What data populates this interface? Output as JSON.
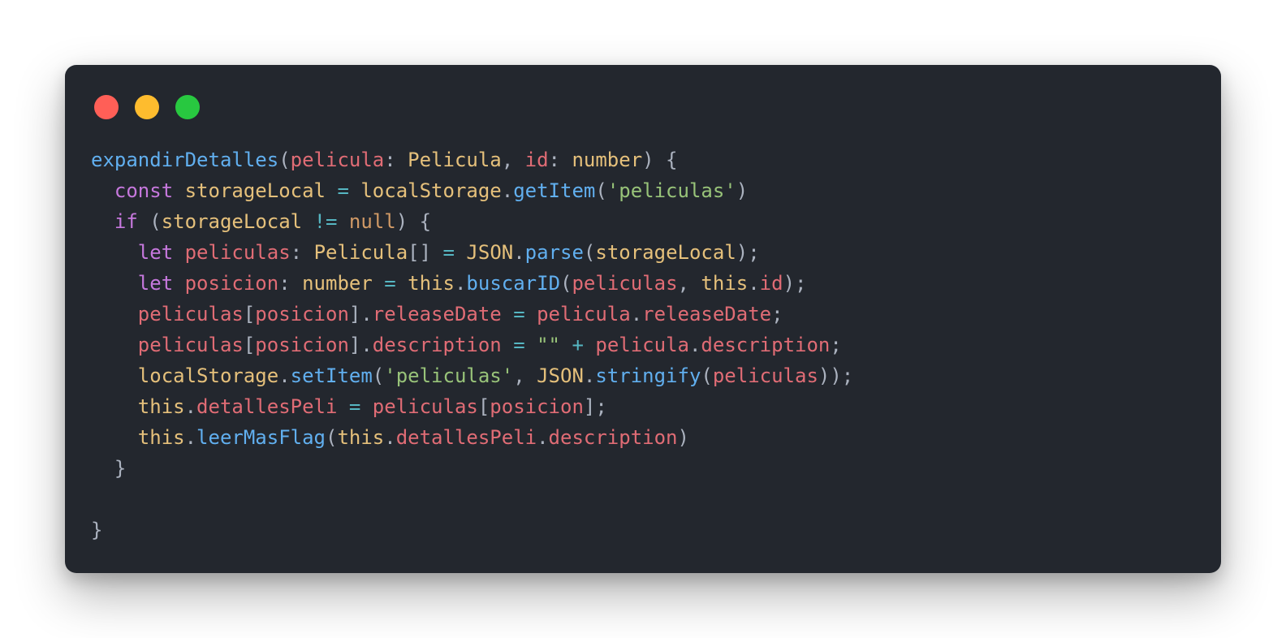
{
  "window": {
    "controls": [
      {
        "name": "close-dot",
        "color": "#ff5f57"
      },
      {
        "name": "minimize-dot",
        "color": "#febc2e"
      },
      {
        "name": "maximize-dot",
        "color": "#28c840"
      }
    ]
  },
  "colors": {
    "default": "#abb2bf",
    "fn": "#61afef",
    "var": "#e06c75",
    "type": "#e5c07b",
    "keyword": "#c678dd",
    "operator": "#56b6c2",
    "string": "#98c379",
    "literal": "#d19a66"
  },
  "code": {
    "lines": [
      [
        [
          "fn",
          "expandirDetalles"
        ],
        [
          "default",
          "("
        ],
        [
          "var",
          "pelicula"
        ],
        [
          "default",
          ": "
        ],
        [
          "type",
          "Pelicula"
        ],
        [
          "default",
          ", "
        ],
        [
          "var",
          "id"
        ],
        [
          "default",
          ": "
        ],
        [
          "type",
          "number"
        ],
        [
          "default",
          ") {"
        ]
      ],
      [
        [
          "default",
          "  "
        ],
        [
          "keyword",
          "const"
        ],
        [
          "default",
          " "
        ],
        [
          "type",
          "storageLocal"
        ],
        [
          "default",
          " "
        ],
        [
          "operator",
          "="
        ],
        [
          "default",
          " "
        ],
        [
          "type",
          "localStorage"
        ],
        [
          "default",
          "."
        ],
        [
          "fn",
          "getItem"
        ],
        [
          "default",
          "("
        ],
        [
          "string",
          "'peliculas'"
        ],
        [
          "default",
          ")"
        ]
      ],
      [
        [
          "default",
          "  "
        ],
        [
          "keyword",
          "if"
        ],
        [
          "default",
          " ("
        ],
        [
          "type",
          "storageLocal"
        ],
        [
          "default",
          " "
        ],
        [
          "operator",
          "!="
        ],
        [
          "default",
          " "
        ],
        [
          "literal",
          "null"
        ],
        [
          "default",
          ") {"
        ]
      ],
      [
        [
          "default",
          "    "
        ],
        [
          "keyword",
          "let"
        ],
        [
          "default",
          " "
        ],
        [
          "var",
          "peliculas"
        ],
        [
          "default",
          ": "
        ],
        [
          "type",
          "Pelicula"
        ],
        [
          "default",
          "[] "
        ],
        [
          "operator",
          "="
        ],
        [
          "default",
          " "
        ],
        [
          "type",
          "JSON"
        ],
        [
          "default",
          "."
        ],
        [
          "fn",
          "parse"
        ],
        [
          "default",
          "("
        ],
        [
          "type",
          "storageLocal"
        ],
        [
          "default",
          ");"
        ]
      ],
      [
        [
          "default",
          "    "
        ],
        [
          "keyword",
          "let"
        ],
        [
          "default",
          " "
        ],
        [
          "var",
          "posicion"
        ],
        [
          "default",
          ": "
        ],
        [
          "type",
          "number"
        ],
        [
          "default",
          " "
        ],
        [
          "operator",
          "="
        ],
        [
          "default",
          " "
        ],
        [
          "type",
          "this"
        ],
        [
          "default",
          "."
        ],
        [
          "fn",
          "buscarID"
        ],
        [
          "default",
          "("
        ],
        [
          "var",
          "peliculas"
        ],
        [
          "default",
          ", "
        ],
        [
          "type",
          "this"
        ],
        [
          "default",
          "."
        ],
        [
          "var",
          "id"
        ],
        [
          "default",
          ");"
        ]
      ],
      [
        [
          "default",
          "    "
        ],
        [
          "var",
          "peliculas"
        ],
        [
          "default",
          "["
        ],
        [
          "var",
          "posicion"
        ],
        [
          "default",
          "]."
        ],
        [
          "var",
          "releaseDate"
        ],
        [
          "default",
          " "
        ],
        [
          "operator",
          "="
        ],
        [
          "default",
          " "
        ],
        [
          "var",
          "pelicula"
        ],
        [
          "default",
          "."
        ],
        [
          "var",
          "releaseDate"
        ],
        [
          "default",
          ";"
        ]
      ],
      [
        [
          "default",
          "    "
        ],
        [
          "var",
          "peliculas"
        ],
        [
          "default",
          "["
        ],
        [
          "var",
          "posicion"
        ],
        [
          "default",
          "]."
        ],
        [
          "var",
          "description"
        ],
        [
          "default",
          " "
        ],
        [
          "operator",
          "="
        ],
        [
          "default",
          " "
        ],
        [
          "string",
          "\"\""
        ],
        [
          "default",
          " "
        ],
        [
          "operator",
          "+"
        ],
        [
          "default",
          " "
        ],
        [
          "var",
          "pelicula"
        ],
        [
          "default",
          "."
        ],
        [
          "var",
          "description"
        ],
        [
          "default",
          ";"
        ]
      ],
      [
        [
          "default",
          "    "
        ],
        [
          "type",
          "localStorage"
        ],
        [
          "default",
          "."
        ],
        [
          "fn",
          "setItem"
        ],
        [
          "default",
          "("
        ],
        [
          "string",
          "'peliculas'"
        ],
        [
          "default",
          ", "
        ],
        [
          "type",
          "JSON"
        ],
        [
          "default",
          "."
        ],
        [
          "fn",
          "stringify"
        ],
        [
          "default",
          "("
        ],
        [
          "var",
          "peliculas"
        ],
        [
          "default",
          "));"
        ]
      ],
      [
        [
          "default",
          "    "
        ],
        [
          "type",
          "this"
        ],
        [
          "default",
          "."
        ],
        [
          "var",
          "detallesPeli"
        ],
        [
          "default",
          " "
        ],
        [
          "operator",
          "="
        ],
        [
          "default",
          " "
        ],
        [
          "var",
          "peliculas"
        ],
        [
          "default",
          "["
        ],
        [
          "var",
          "posicion"
        ],
        [
          "default",
          "];"
        ]
      ],
      [
        [
          "default",
          "    "
        ],
        [
          "type",
          "this"
        ],
        [
          "default",
          "."
        ],
        [
          "fn",
          "leerMasFlag"
        ],
        [
          "default",
          "("
        ],
        [
          "type",
          "this"
        ],
        [
          "default",
          "."
        ],
        [
          "var",
          "detallesPeli"
        ],
        [
          "default",
          "."
        ],
        [
          "var",
          "description"
        ],
        [
          "default",
          ")"
        ]
      ],
      [
        [
          "default",
          "  }"
        ]
      ],
      [],
      [
        [
          "default",
          "}"
        ]
      ]
    ]
  }
}
